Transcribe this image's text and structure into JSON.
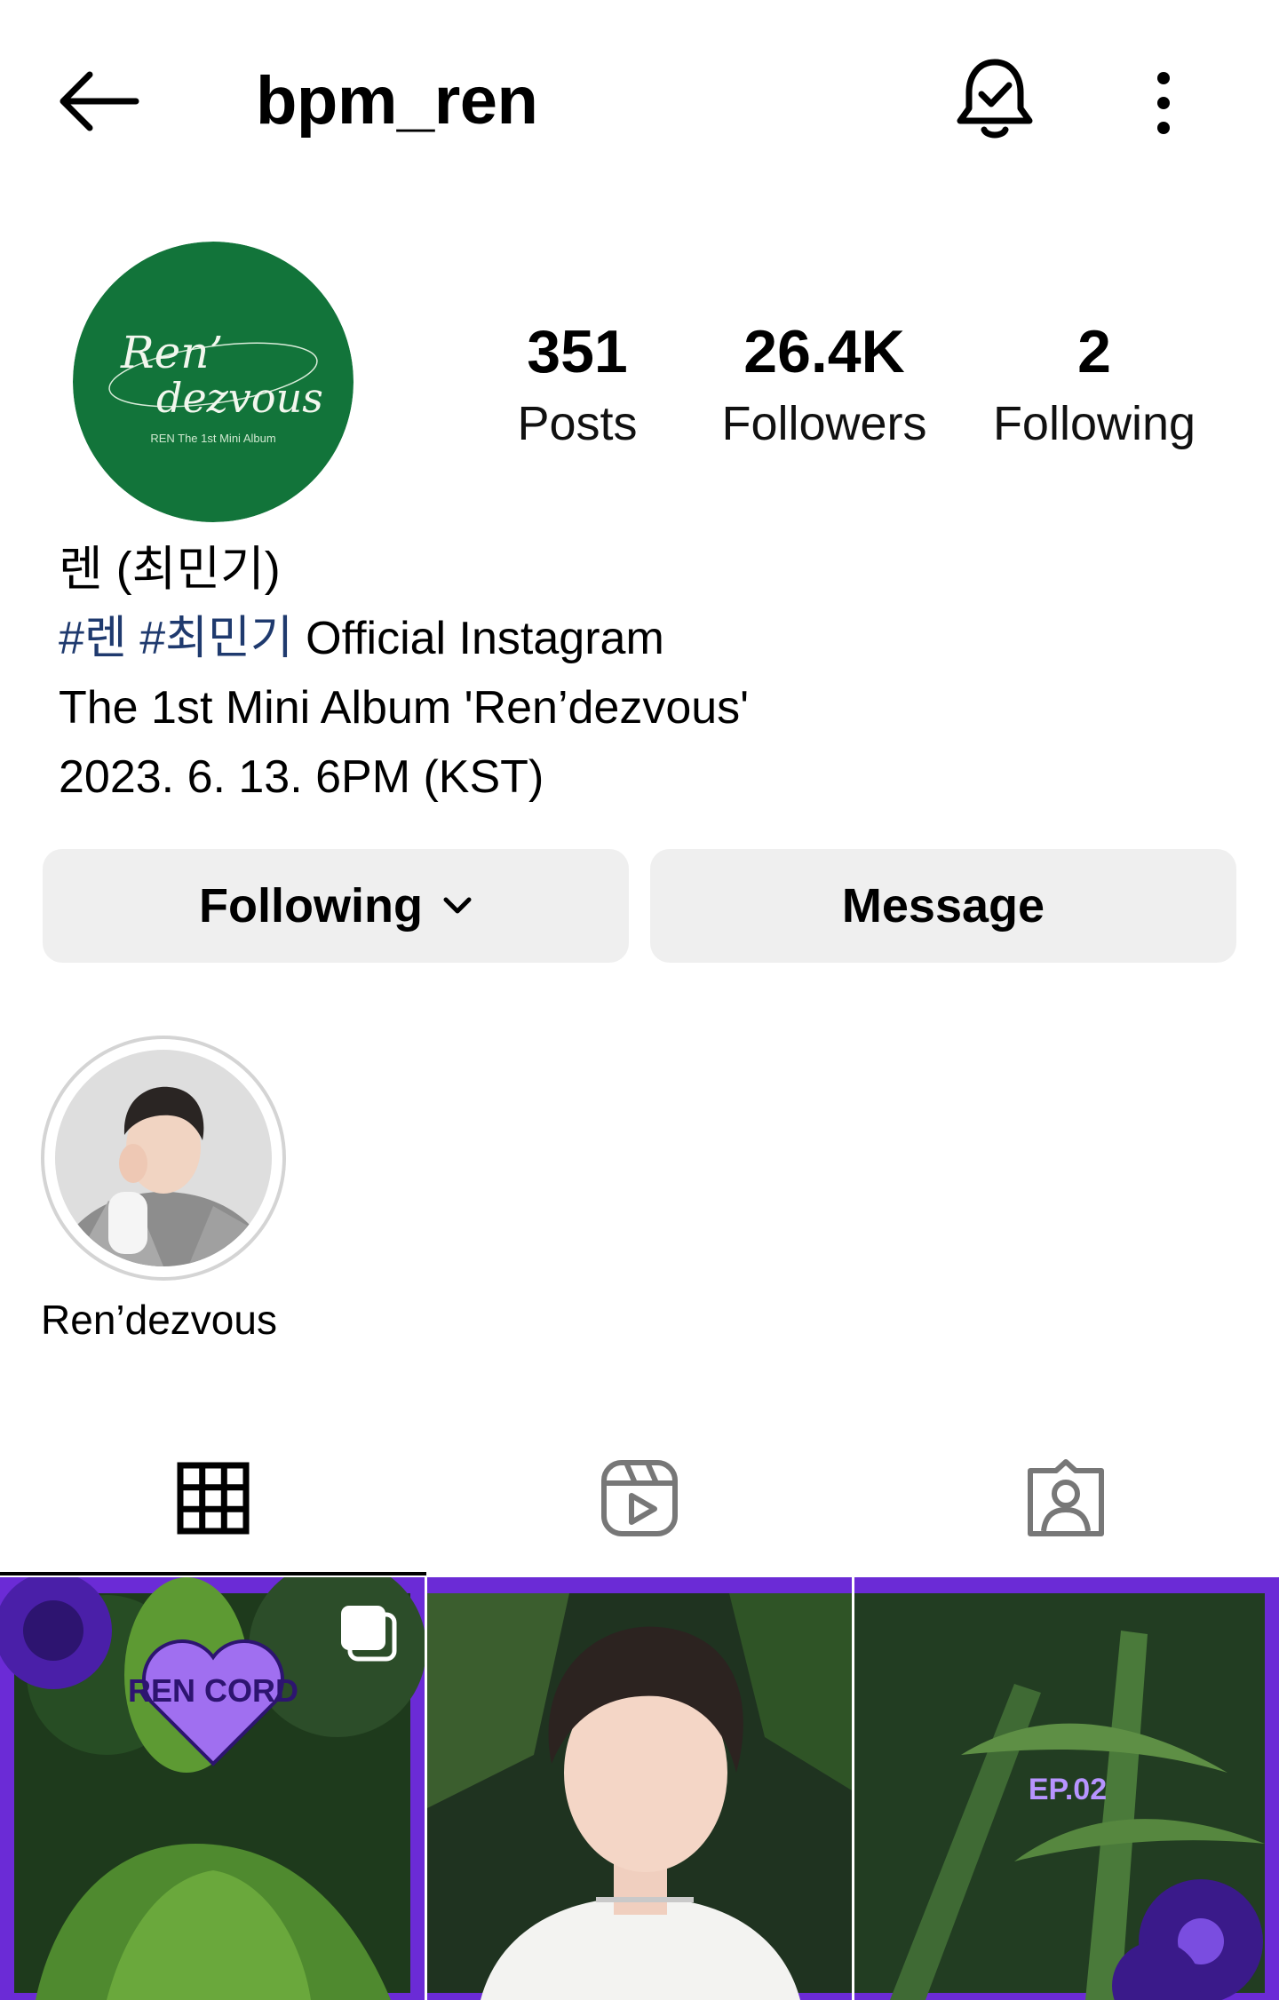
{
  "header": {
    "username": "bpm_ren",
    "back_icon": "arrow-left-icon",
    "bell_icon": "bell-check-icon",
    "more_icon": "more-vertical-icon"
  },
  "profile": {
    "avatar_text_line1": "Ren’",
    "avatar_text_line2": "dezvous",
    "avatar_caption": "REN The 1st Mini Album",
    "avatar_color": "#12743a"
  },
  "stats": [
    {
      "value": "351",
      "label": "Posts"
    },
    {
      "value": "26.4K",
      "label": "Followers"
    },
    {
      "value": "2",
      "label": "Following"
    }
  ],
  "bio": {
    "name": "렌 (최민기)",
    "hashtag1": "#렌",
    "hashtag2": "#최민기",
    "line2_rest": " Official Instagram",
    "line3": "The 1st Mini Album 'Ren’dezvous'",
    "line4": "2023. 6. 13. 6PM (KST)"
  },
  "actions": {
    "following_label": "Following",
    "message_label": "Message"
  },
  "highlights": [
    {
      "label": "Ren’dezvous"
    }
  ],
  "tabs": [
    {
      "name": "grid",
      "icon": "grid-icon",
      "active": true
    },
    {
      "name": "reels",
      "icon": "reels-icon",
      "active": false
    },
    {
      "name": "tagged",
      "icon": "tagged-person-icon",
      "active": false
    }
  ],
  "posts": [
    {
      "sticker": "REN CORD",
      "multi": true
    },
    {
      "multi": false
    },
    {
      "sticker": "EP.02",
      "multi": false
    }
  ],
  "colors": {
    "accent_purple": "#6b2bd6",
    "hashtag_blue": "#1f3a6e",
    "button_bg": "#efefef"
  }
}
